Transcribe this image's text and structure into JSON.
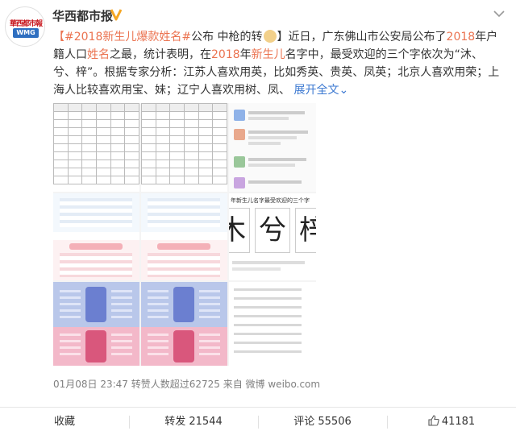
{
  "post": {
    "author": "华西都市报",
    "avatar_text_top": "華西都市報",
    "avatar_text_badge": "WMG",
    "text_segments": [
      {
        "text": "【#2018新生儿爆款姓名#",
        "style": "red"
      },
      {
        "text": "公布 中枪的转",
        "style": "normal"
      },
      {
        "text": "】近日，广东佛山市公安局公布了",
        "style": "normal"
      },
      {
        "text": "2018",
        "style": "red"
      },
      {
        "text": "年户籍人口",
        "style": "normal"
      },
      {
        "text": "姓名",
        "style": "red"
      },
      {
        "text": "之最，统计表明，在",
        "style": "normal"
      },
      {
        "text": "2018",
        "style": "red"
      },
      {
        "text": "年",
        "style": "normal"
      },
      {
        "text": "新生儿",
        "style": "red"
      },
      {
        "text": "名字中，最受欢迎的三个字依次为“沐、兮、梓”。根据专家分析：江苏人喜欢用英，比如秀英、贵英、凤英；北京人喜欢用荣；上海人比较喜欢用宝、妹；辽宁人喜欢用树、凤、",
        "style": "normal"
      },
      {
        "text": " 展开全文",
        "style": "fold"
      },
      {
        "text": "⌄",
        "style": "fold"
      }
    ],
    "collage_heading": "年新生儿名字最受欢迎的三个字",
    "collage_chars": [
      "木",
      "兮",
      "梓"
    ],
    "meta": "01月08日 23:47 转赞人数超过62725 来自 微博 weibo.com"
  },
  "actions": {
    "favorite_label": "收藏",
    "repost_label": "转发 21544",
    "comment_label": "评论 55506",
    "like_label": "41181"
  },
  "colors": {
    "link": "#eb7350",
    "fold": "#3b78d1",
    "verify": "#f5a623",
    "meta": "#808080"
  },
  "icons": [
    "verified-badge-icon",
    "chevron-down-icon",
    "thumbs-up-icon",
    "doge-emoji-icon"
  ]
}
